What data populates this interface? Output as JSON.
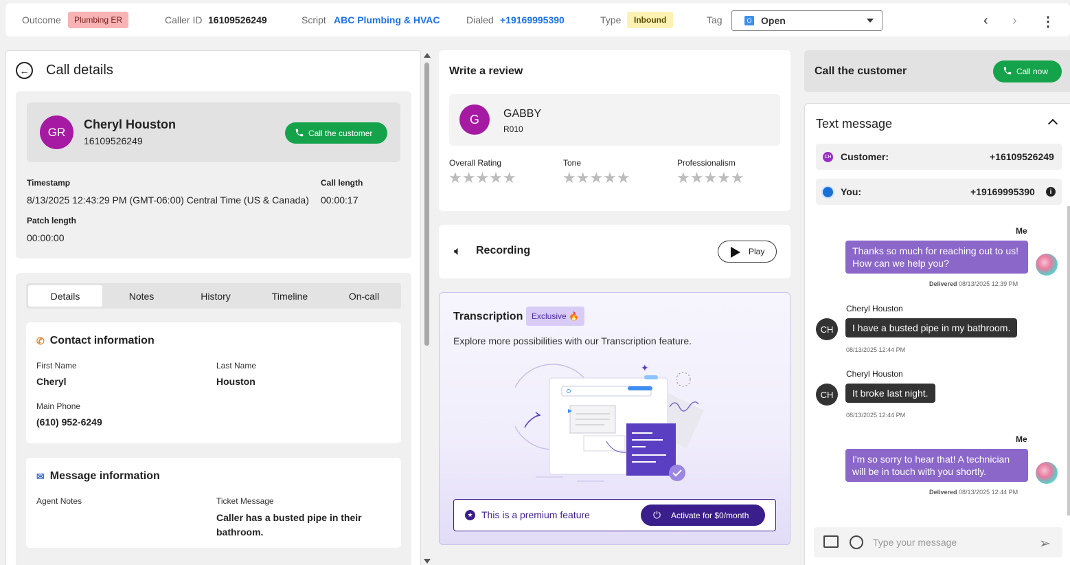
{
  "topbar": {
    "outcome_label": "Outcome",
    "outcome_value": "Plumbing ER",
    "caller_id_label": "Caller ID",
    "caller_id_value": "16109526249",
    "script_label": "Script",
    "script_value": "ABC Plumbing & HVAC",
    "dialed_label": "Dialed",
    "dialed_value": "+19169995390",
    "type_label": "Type",
    "type_value": "Inbound",
    "tag_label": "Tag",
    "tag_icon_letter": "O",
    "tag_value": "Open"
  },
  "call_details": {
    "title": "Call details",
    "caller": {
      "initials": "GR",
      "name": "Cheryl Houston",
      "number": "16109526249",
      "call_button": "Call the customer"
    },
    "timestamp_label": "Timestamp",
    "timestamp_value": "8/13/2025 12:43:29 PM (GMT-06:00) Central Time (US & Canada)",
    "call_length_label": "Call length",
    "call_length_value": "00:00:17",
    "patch_length_label": "Patch length",
    "patch_length_value": "00:00:00"
  },
  "tabs": [
    {
      "label": "Details",
      "active": true
    },
    {
      "label": "Notes",
      "active": false
    },
    {
      "label": "History",
      "active": false
    },
    {
      "label": "Timeline",
      "active": false
    },
    {
      "label": "On-call",
      "active": false
    }
  ],
  "contact": {
    "title": "Contact information",
    "first_name_label": "First Name",
    "first_name": "Cheryl",
    "last_name_label": "Last Name",
    "last_name": "Houston",
    "main_phone_label": "Main Phone",
    "main_phone": "(610) 952-6249"
  },
  "message_info": {
    "title": "Message information",
    "agent_notes_label": "Agent Notes",
    "ticket_message_label": "Ticket Message",
    "ticket_message": "Caller has a busted pipe in their bathroom."
  },
  "review": {
    "title": "Write a review",
    "agent_initial": "G",
    "agent_name": "GABBY",
    "agent_code": "R010",
    "ratings": [
      {
        "label": "Overall Rating",
        "stars": "★★★★★",
        "value": 0
      },
      {
        "label": "Tone",
        "stars": "★★★★★",
        "value": 0
      },
      {
        "label": "Professionalism",
        "stars": "★★★★★",
        "value": 0
      }
    ]
  },
  "recording": {
    "title": "Recording",
    "play_label": "Play"
  },
  "transcription": {
    "title": "Transcription",
    "badge": "Exclusive 🔥",
    "description": "Explore more possibilities with our Transcription feature.",
    "premium_text": "This is a premium feature",
    "activate_label": "Activate for $0/month"
  },
  "call_customer": {
    "title": "Call the customer",
    "button": "Call now"
  },
  "text_message": {
    "title": "Text message",
    "customer_icon": "CH",
    "customer_label": "Customer:",
    "customer_number": "+16109526249",
    "you_label": "You:",
    "you_number": "+19169995390",
    "messages": [
      {
        "from": "me",
        "sender": "Me",
        "text": "Thanks so much for reaching out to us! How can we help you?",
        "status": "Delivered",
        "time": "08/13/2025 12:39 PM"
      },
      {
        "from": "customer",
        "sender": "Cheryl Houston",
        "initials": "CH",
        "text": "I have a busted pipe in my bathroom.",
        "time": "08/13/2025 12:44 PM"
      },
      {
        "from": "customer",
        "sender": "Cheryl Houston",
        "initials": "CH",
        "text": "It broke last night.",
        "time": "08/13/2025 12:44 PM"
      },
      {
        "from": "me",
        "sender": "Me",
        "text": "I'm so sorry to hear that! A technician will be in touch with you shortly.",
        "status": "Delivered",
        "time": "08/13/2025 12:44 PM"
      }
    ],
    "compose_placeholder": "Type your message"
  },
  "colors": {
    "accent_green": "#14a34a",
    "avatar_purple": "#a61aa3",
    "me_bubble": "#8a67c9",
    "premium_dark": "#3a1e8c",
    "link_blue": "#1a73e8"
  }
}
